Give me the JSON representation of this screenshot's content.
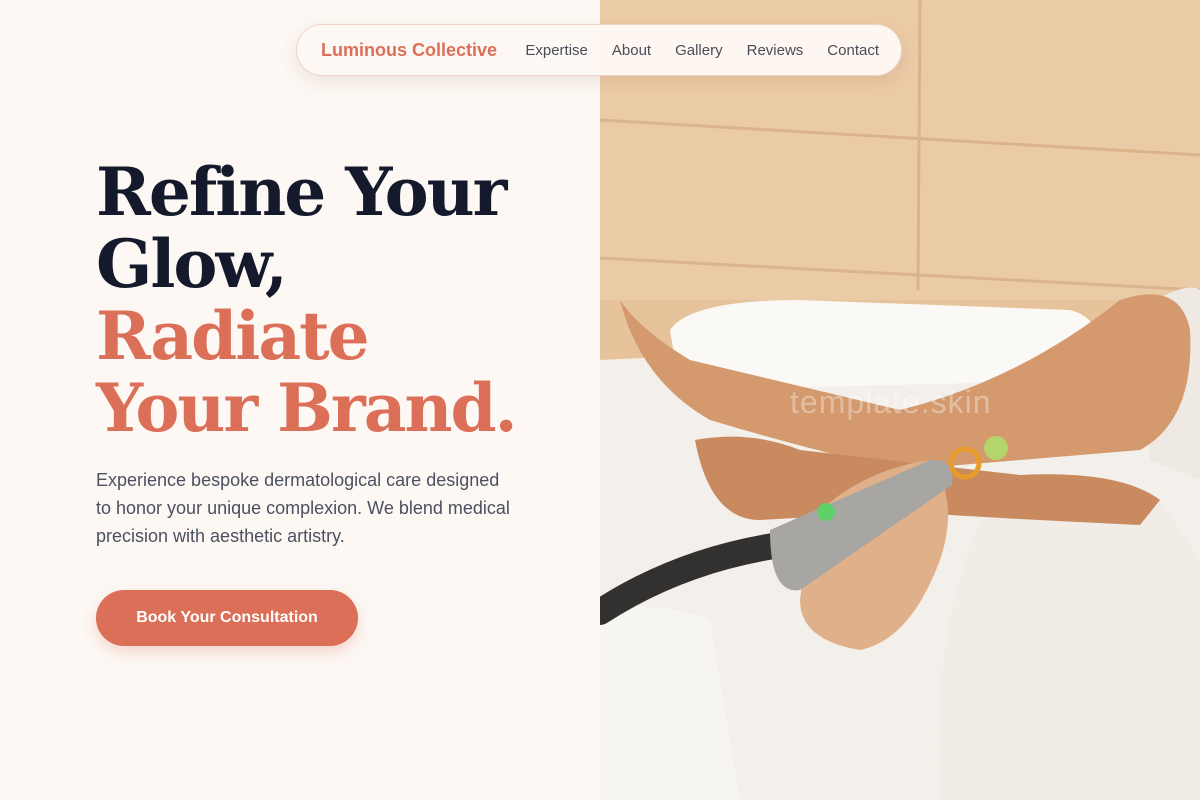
{
  "nav": {
    "brand": "Luminous Collective",
    "links": [
      "Expertise",
      "About",
      "Gallery",
      "Reviews",
      "Contact"
    ]
  },
  "hero": {
    "headline": {
      "line1": "Refine Your",
      "line2": "Glow,",
      "line3": "Radiate",
      "line4": "Your Brand."
    },
    "description": "Experience bespoke dermatological care designed to honor your unique complexion. We blend medical precision with aesthetic artistry.",
    "cta_label": "Book Your Consultation",
    "image_alt": "Laser hair removal treatment on a leg",
    "watermark": "template.skin"
  },
  "colors": {
    "accent": "#db6f57",
    "dark_text": "#141a2b",
    "body_text": "#4b5060",
    "background": "#fdf8f4"
  }
}
